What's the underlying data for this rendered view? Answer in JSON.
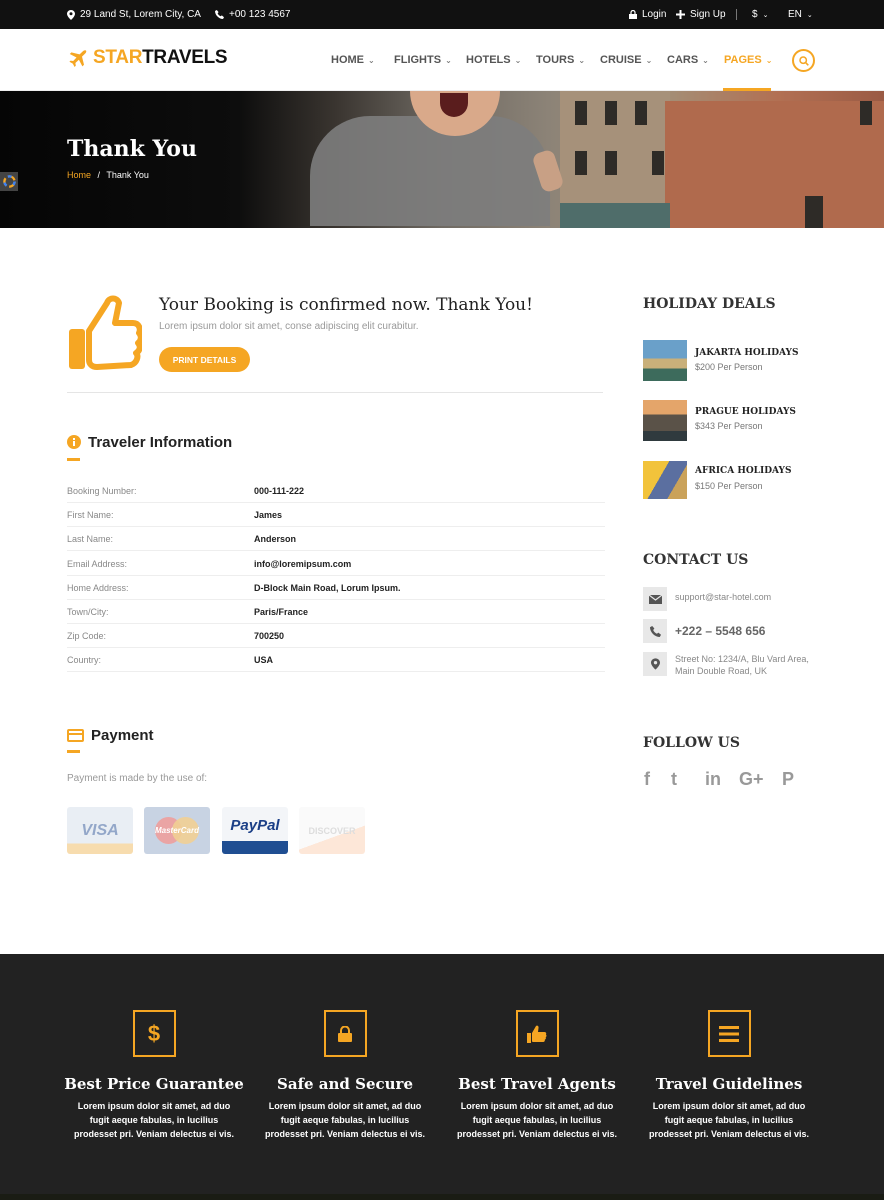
{
  "topbar": {
    "address": "29 Land St, Lorem City, CA",
    "phone": "+00 123 4567",
    "login": "Login",
    "signup": "Sign Up",
    "currency": "$",
    "language": "EN"
  },
  "header": {
    "logo_a": "STAR",
    "logo_b": "TRAVELS",
    "nav": [
      "HOME",
      "FLIGHTS",
      "HOTELS",
      "TOURS",
      "CRUISE",
      "CARS",
      "PAGES"
    ],
    "active": "PAGES"
  },
  "hero": {
    "title": "Thank You",
    "breadcrumb_home": "Home",
    "breadcrumb_sep": "/",
    "breadcrumb_current": "Thank You"
  },
  "confirm": {
    "title": "Your Booking is confirmed now. Thank You!",
    "subtitle": "Lorem ipsum dolor sit amet, conse adipiscing elit curabitur.",
    "button": "PRINT DETAILS"
  },
  "traveler": {
    "heading": "Traveler Information",
    "rows": [
      {
        "label": "Booking Number:",
        "value": "000-111-222"
      },
      {
        "label": "First Name:",
        "value": "James"
      },
      {
        "label": "Last Name:",
        "value": "Anderson"
      },
      {
        "label": "Email Address:",
        "value": "info@loremipsum.com"
      },
      {
        "label": "Home Address:",
        "value": "D-Block Main Road, Lorum Ipsum."
      },
      {
        "label": "Town/City:",
        "value": "Paris/France"
      },
      {
        "label": "Zip Code:",
        "value": "700250"
      },
      {
        "label": "Country:",
        "value": "USA"
      }
    ]
  },
  "payment": {
    "heading": "Payment",
    "text": "Payment is made by the use of:",
    "cards": [
      "VISA",
      "MasterCard",
      "PayPal",
      "DISCOVER"
    ]
  },
  "sidebar": {
    "deals_heading": "HOLIDAY DEALS",
    "deals": [
      {
        "title": "JAKARTA HOLIDAYS",
        "price": "$200 Per Person"
      },
      {
        "title": "PRAGUE HOLIDAYS",
        "price": "$343 Per Person"
      },
      {
        "title": "AFRICA HOLIDAYS",
        "price": "$150 Per Person"
      }
    ],
    "contact_heading": "CONTACT US",
    "email": "support@star-hotel.com",
    "phone": "+222 – 5548 656",
    "address_line1": "Street No: 1234/A, Blu Vard Area,",
    "address_line2": "Main Double Road, UK",
    "follow_heading": "FOLLOW US",
    "social": [
      "f",
      "t",
      "in",
      "G+",
      "P"
    ]
  },
  "footer": {
    "features": [
      {
        "title": "Best Price Guarantee",
        "desc": "Lorem ipsum dolor sit amet, ad duo fugit aeque fabulas, in lucilius prodesset pri. Veniam delectus ei vis."
      },
      {
        "title": "Safe and Secure",
        "desc": "Lorem ipsum dolor sit amet, ad duo fugit aeque fabulas, in lucilius prodesset pri. Veniam delectus ei vis."
      },
      {
        "title": "Best Travel Agents",
        "desc": "Lorem ipsum dolor sit amet, ad duo fugit aeque fabulas, in lucilius prodesset pri. Veniam delectus ei vis."
      },
      {
        "title": "Travel Guidelines",
        "desc": "Lorem ipsum dolor sit amet, ad duo fugit aeque fabulas, in lucilius prodesset pri. Veniam delectus ei vis."
      }
    ]
  },
  "colors": {
    "accent": "#f5a623",
    "dark": "#111111",
    "footer": "#222222"
  },
  "icons": {
    "address": "map-pin-icon",
    "phone": "phone-icon",
    "login": "lock-icon",
    "signup": "plus-icon",
    "search": "search-icon",
    "thumb": "thumbs-up-icon",
    "info": "info-icon",
    "payment": "credit-card-icon"
  }
}
